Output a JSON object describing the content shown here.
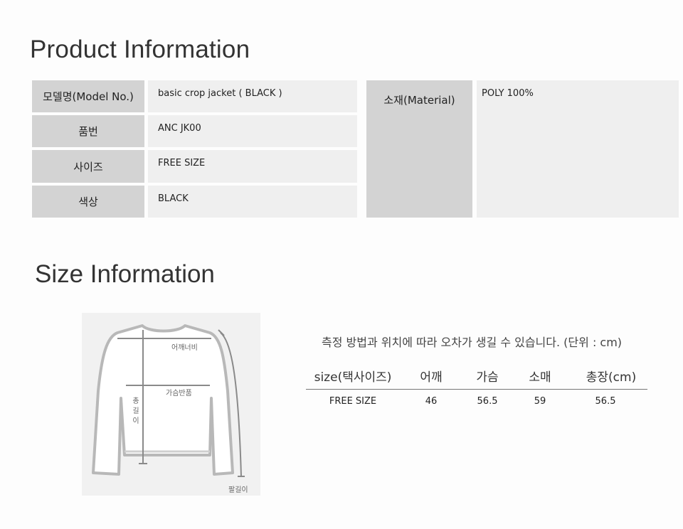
{
  "product_info": {
    "title": "Product Information",
    "rows": [
      {
        "label": "모델명(Model No.)",
        "value": "basic crop jacket ( BLACK )"
      },
      {
        "label": "품번",
        "value": "ANC JK00"
      },
      {
        "label": "사이즈",
        "value": "FREE SIZE"
      },
      {
        "label": "색상",
        "value": "BLACK"
      }
    ],
    "material": {
      "label": "소재(Material)",
      "value": "POLY 100%"
    }
  },
  "size_info": {
    "title": "Size Information",
    "note": "측정 방법과 위치에 따라 오차가 생길 수 있습니다. (단위 : cm)",
    "diagram_labels": {
      "shoulder": "어깨너비",
      "chest": "가슴반품",
      "length": "총\n길\n이",
      "sleeve": "팔길이"
    },
    "table": {
      "headers": [
        "size(택사이즈)",
        "어깨",
        "가슴",
        "소매",
        "총장(cm)"
      ],
      "rows": [
        [
          "FREE SIZE",
          "46",
          "56.5",
          "59",
          "56.5"
        ]
      ]
    }
  }
}
